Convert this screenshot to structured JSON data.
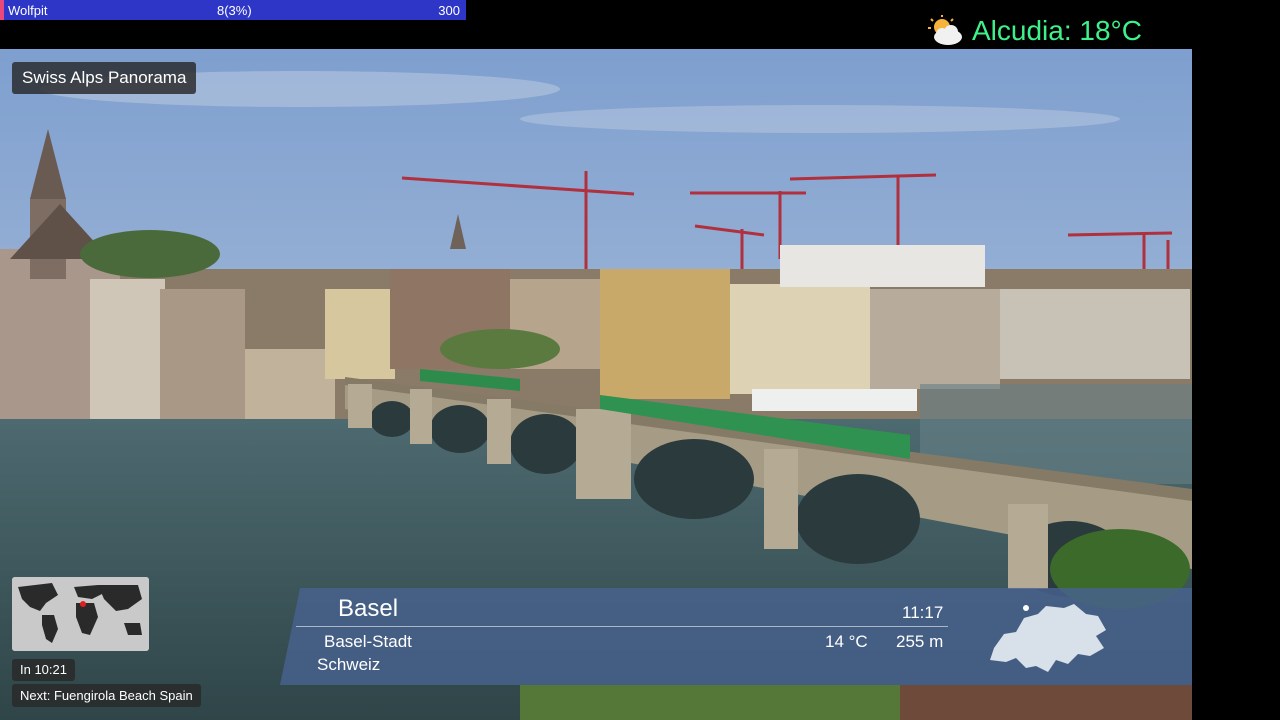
{
  "progress": {
    "name": "Wolfpit",
    "value": "8(3%)",
    "goal": "300",
    "fraction": 0.03,
    "colors": {
      "track": "#2e36c7",
      "fill": "#e8487a"
    }
  },
  "weather": {
    "icon": "partly-cloudy-icon",
    "text": "Alcudia: 18°C",
    "color": "#3df28a"
  },
  "stream": {
    "title": "Swiss Alps Panorama",
    "timer": "In 10:21",
    "next": "Next: Fuengirola Beach Spain"
  },
  "location": {
    "city": "Basel",
    "region": "Basel-Stadt",
    "country": "Schweiz",
    "time": "11:17",
    "temperature": "14 °C",
    "elevation": "255 m"
  }
}
